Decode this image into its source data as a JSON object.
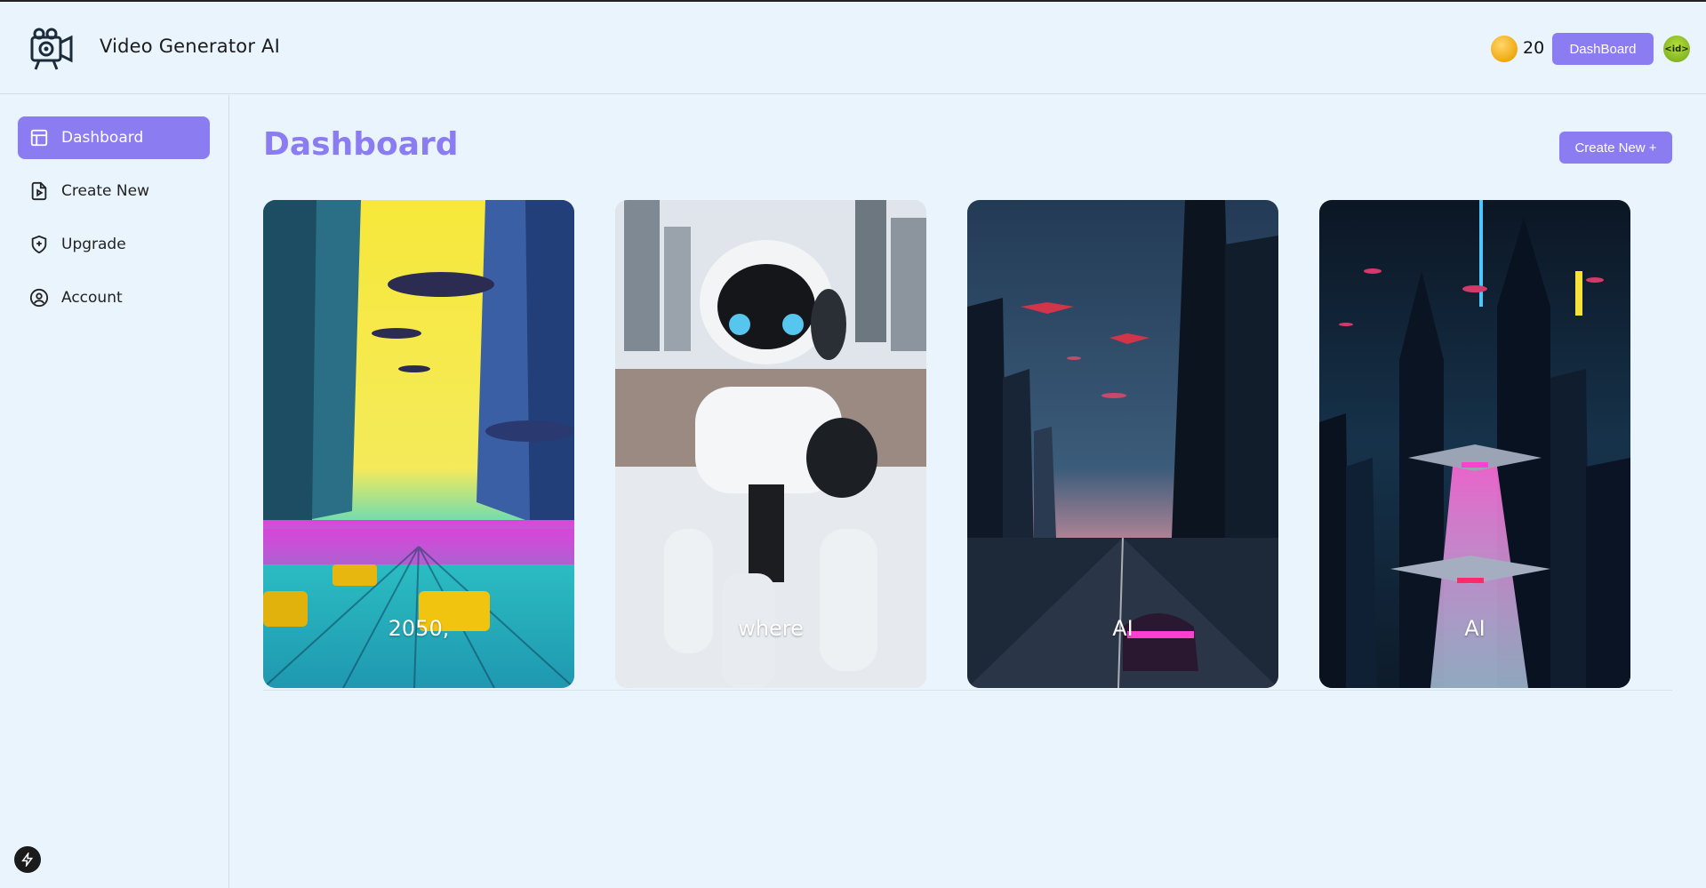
{
  "app": {
    "title": "Video Generator AI"
  },
  "header": {
    "credits": "20",
    "dashboard_label": "DashBoard",
    "avatar_text": "<id>"
  },
  "sidebar": {
    "items": [
      {
        "label": "Dashboard",
        "icon": "layout-icon",
        "active": true
      },
      {
        "label": "Create New",
        "icon": "file-video-icon",
        "active": false
      },
      {
        "label": "Upgrade",
        "icon": "shield-plus-icon",
        "active": false
      },
      {
        "label": "Account",
        "icon": "user-circle-icon",
        "active": false
      }
    ]
  },
  "main": {
    "title": "Dashboard",
    "create_label": "Create New +",
    "videos": [
      {
        "caption": "2050,"
      },
      {
        "caption": "where"
      },
      {
        "caption": "AI"
      },
      {
        "caption": "AI"
      }
    ]
  },
  "colors": {
    "accent": "#8b7cf2",
    "background": "#e9f4fd"
  }
}
